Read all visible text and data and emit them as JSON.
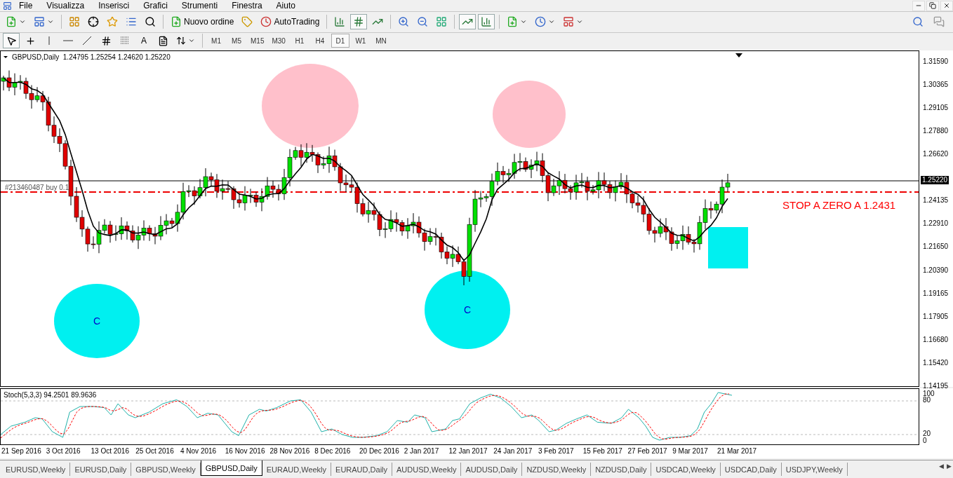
{
  "menu": [
    "File",
    "Visualizza",
    "Inserisci",
    "Grafici",
    "Strumenti",
    "Finestra",
    "Aiuto"
  ],
  "toolbar": {
    "new_order": "Nuovo ordine",
    "autotrading": "AutoTrading",
    "chart_types": [
      {
        "kind": "bar",
        "selected": false
      },
      {
        "kind": "candle",
        "selected": true
      },
      {
        "kind": "line",
        "selected": false
      }
    ],
    "auto_scroll": {
      "on": true
    },
    "chart_shift": {
      "on": true
    }
  },
  "tools": [
    {
      "kind": "cursor",
      "selected": true
    },
    {
      "kind": "crosshair",
      "selected": false
    },
    {
      "kind": "vline",
      "selected": false
    },
    {
      "kind": "hline",
      "selected": false
    },
    {
      "kind": "trend",
      "selected": false
    },
    {
      "kind": "channel",
      "selected": false
    },
    {
      "kind": "fibo",
      "selected": false
    },
    {
      "kind": "text",
      "label": "A",
      "selected": false
    },
    {
      "kind": "label",
      "selected": false
    },
    {
      "kind": "arrows",
      "selected": false
    }
  ],
  "timeframes": [
    {
      "label": "M1",
      "selected": false
    },
    {
      "label": "M5",
      "selected": false
    },
    {
      "label": "M15",
      "selected": false
    },
    {
      "label": "M30",
      "selected": false
    },
    {
      "label": "H1",
      "selected": false
    },
    {
      "label": "H4",
      "selected": false
    },
    {
      "label": "D1",
      "selected": true
    },
    {
      "label": "W1",
      "selected": false
    },
    {
      "label": "MN",
      "selected": false
    }
  ],
  "chart": {
    "symbol": "GBPUSD,Daily",
    "ohlc": "1.24795 1.25254 1.24620 1.25220",
    "order_label": "#213460487 buy 0.1",
    "note": "STOP A ZERO A 1.2431",
    "current_price": "1.25220",
    "price_ticks": [
      "1.31590",
      "1.30365",
      "1.29105",
      "1.27880",
      "1.26620",
      "1.24135",
      "1.22910",
      "1.21650",
      "1.20390",
      "1.19165",
      "1.17905",
      "1.16680",
      "1.15420",
      "1.14195"
    ],
    "shapes": [
      {
        "kind": "ellipse",
        "color": "#ffc0cb"
      },
      {
        "kind": "ellipse",
        "color": "#ffc0cb"
      },
      {
        "kind": "ellipse",
        "color": "#00f0f0",
        "label": "C"
      },
      {
        "kind": "ellipse",
        "color": "#00f0f0",
        "label": "C"
      },
      {
        "kind": "rect",
        "color": "#00f0f0"
      }
    ]
  },
  "stochastic": {
    "label": "Stoch(5,3,3) 94.2501 89.9636",
    "ticks": [
      "100",
      "80",
      "20",
      "0"
    ]
  },
  "dates": [
    "21 Sep 2016",
    "3 Oct 2016",
    "13 Oct 2016",
    "25 Oct 2016",
    "4 Nov 2016",
    "16 Nov 2016",
    "28 Nov 2016",
    "8 Dec 2016",
    "20 Dec 2016",
    "2 Jan 2017",
    "12 Jan 2017",
    "24 Jan 2017",
    "3 Feb 2017",
    "15 Feb 2017",
    "27 Feb 2017",
    "9 Mar 2017",
    "21 Mar 2017"
  ],
  "tabs": [
    {
      "label": "EURUSD,Weekly",
      "selected": false
    },
    {
      "label": "EURUSD,Daily",
      "selected": false
    },
    {
      "label": "GBPUSD,Weekly",
      "selected": false
    },
    {
      "label": "GBPUSD,Daily",
      "selected": true
    },
    {
      "label": "EURAUD,Weekly",
      "selected": false
    },
    {
      "label": "EURAUD,Daily",
      "selected": false
    },
    {
      "label": "AUDUSD,Weekly",
      "selected": false
    },
    {
      "label": "AUDUSD,Daily",
      "selected": false
    },
    {
      "label": "NZDUSD,Weekly",
      "selected": false
    },
    {
      "label": "NZDUSD,Daily",
      "selected": false
    },
    {
      "label": "USDCAD,Weekly",
      "selected": false
    },
    {
      "label": "USDCAD,Daily",
      "selected": false
    },
    {
      "label": "USDJPY,Weekly",
      "selected": false
    }
  ],
  "tab_scroll": [
    "◀",
    "▶"
  ]
}
